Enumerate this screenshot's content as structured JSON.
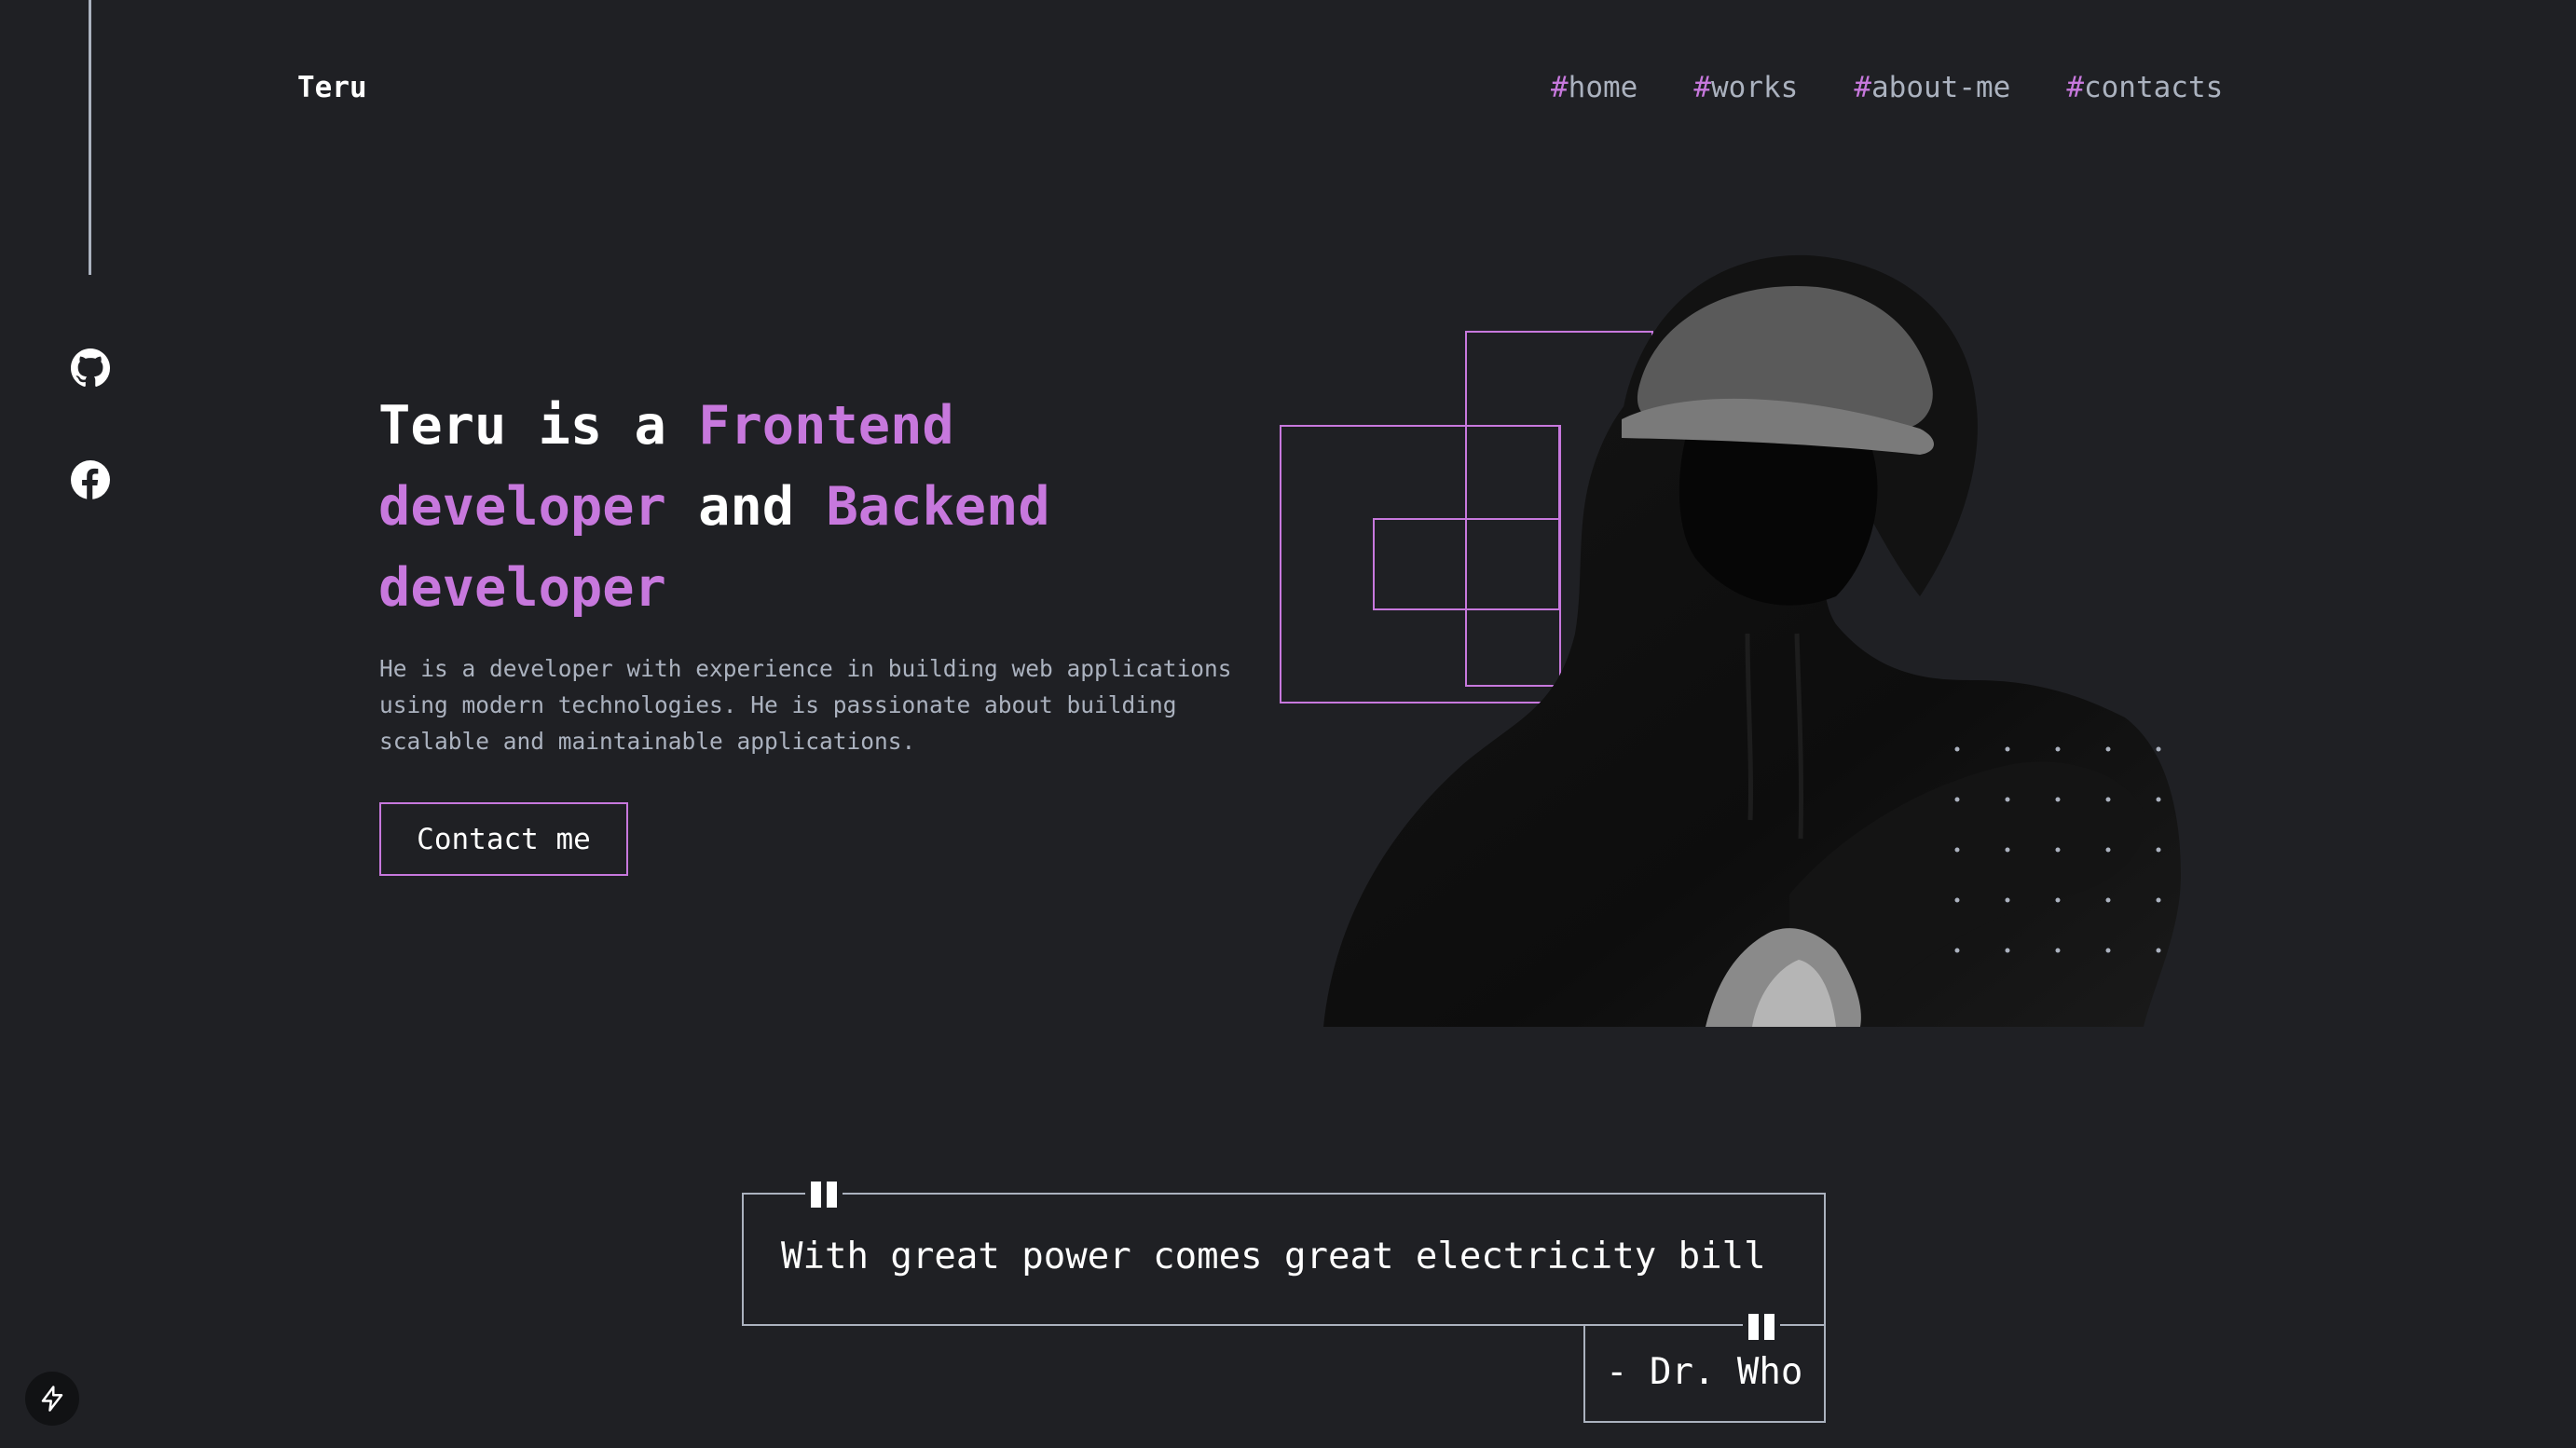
{
  "header": {
    "logo": "Teru",
    "nav": [
      {
        "hash": "#",
        "label": "home"
      },
      {
        "hash": "#",
        "label": "works"
      },
      {
        "hash": "#",
        "label": "about-me"
      },
      {
        "hash": "#",
        "label": "contacts"
      }
    ]
  },
  "social": {
    "icons": [
      "github-icon",
      "facebook-icon"
    ]
  },
  "hero": {
    "headline": {
      "p1": "Teru is a ",
      "p2": "Frontend developer",
      "p3": " and ",
      "p4": "Backend developer"
    },
    "description": "He is a developer with experience in building web applications using modern technologies. He is passionate about building scalable and maintainable applications.",
    "button_label": "Contact me",
    "image": "hooded-figure-photo"
  },
  "quote": {
    "text": "With great power comes great electricity bill",
    "author": "- Dr. Who"
  },
  "colors": {
    "background": "#1f2024",
    "accent": "#c778dd",
    "muted": "#abb2bf",
    "text": "#ffffff"
  },
  "badge": {
    "icon": "lightning-bolt-icon"
  }
}
